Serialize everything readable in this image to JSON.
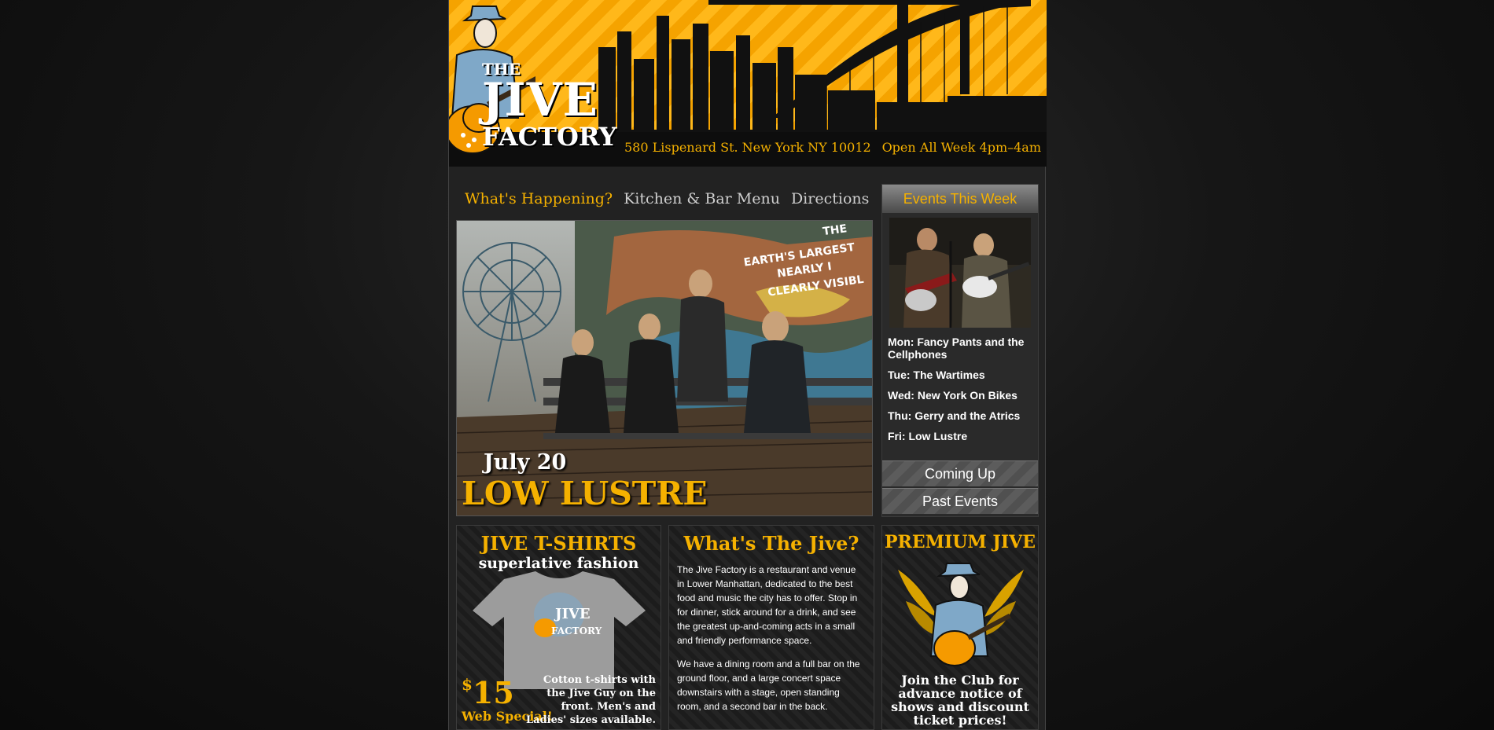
{
  "header": {
    "address": "580 Lispenard St. New York NY 10012",
    "hours": "Open All Week 4pm–4am",
    "logo": {
      "the": "THE",
      "jive": "JIVE",
      "factory": "FACTORY"
    }
  },
  "nav": {
    "items": [
      {
        "label": "What's Happening?",
        "active": true
      },
      {
        "label": "Kitchen & Bar Menu",
        "active": false
      },
      {
        "label": "Directions",
        "active": false
      }
    ]
  },
  "feature": {
    "date": "July 20",
    "band": "LOW LUSTRE",
    "mural_text": [
      "THE",
      "EARTH'S LARGEST",
      "NEARLY I",
      "CLEARLY VISIBL"
    ]
  },
  "sidebar": {
    "title": "Events This Week",
    "events": [
      "Mon: Fancy Pants and the Cellphones",
      "Tue: The Wartimes",
      "Wed: New York On Bikes",
      "Thu: Gerry and the Atrics",
      "Fri: Low Lustre"
    ],
    "coming_up": "Coming Up",
    "past_events": "Past Events"
  },
  "shirts": {
    "title": "JIVE T-SHIRTS",
    "subtitle": "superlative fashion",
    "dollar": "$",
    "price": "15",
    "web_special": "Web Special!",
    "description": "Cotton t-shirts with the Jive Guy on the front. Men's and Ladies' sizes available."
  },
  "about": {
    "title": "What's The Jive?",
    "paragraphs": [
      "The Jive Factory is a restaurant and venue in Lower Manhattan, dedicated to the best food and music the city has to offer. Stop in for dinner, stick around for a drink, and see the greatest up-and-coming acts in a small and friendly performance space.",
      "We have a dining room and a full bar on the ground floor, and a large concert space downstairs with a stage, open standing room, and a second bar in the back."
    ]
  },
  "premium": {
    "title": "PREMIUM JIVE",
    "description": "Join the Club for advance notice of shows and discount ticket prices!"
  },
  "colors": {
    "accent": "#f5b100",
    "background": "#0a0a0a",
    "panel": "#222222"
  }
}
